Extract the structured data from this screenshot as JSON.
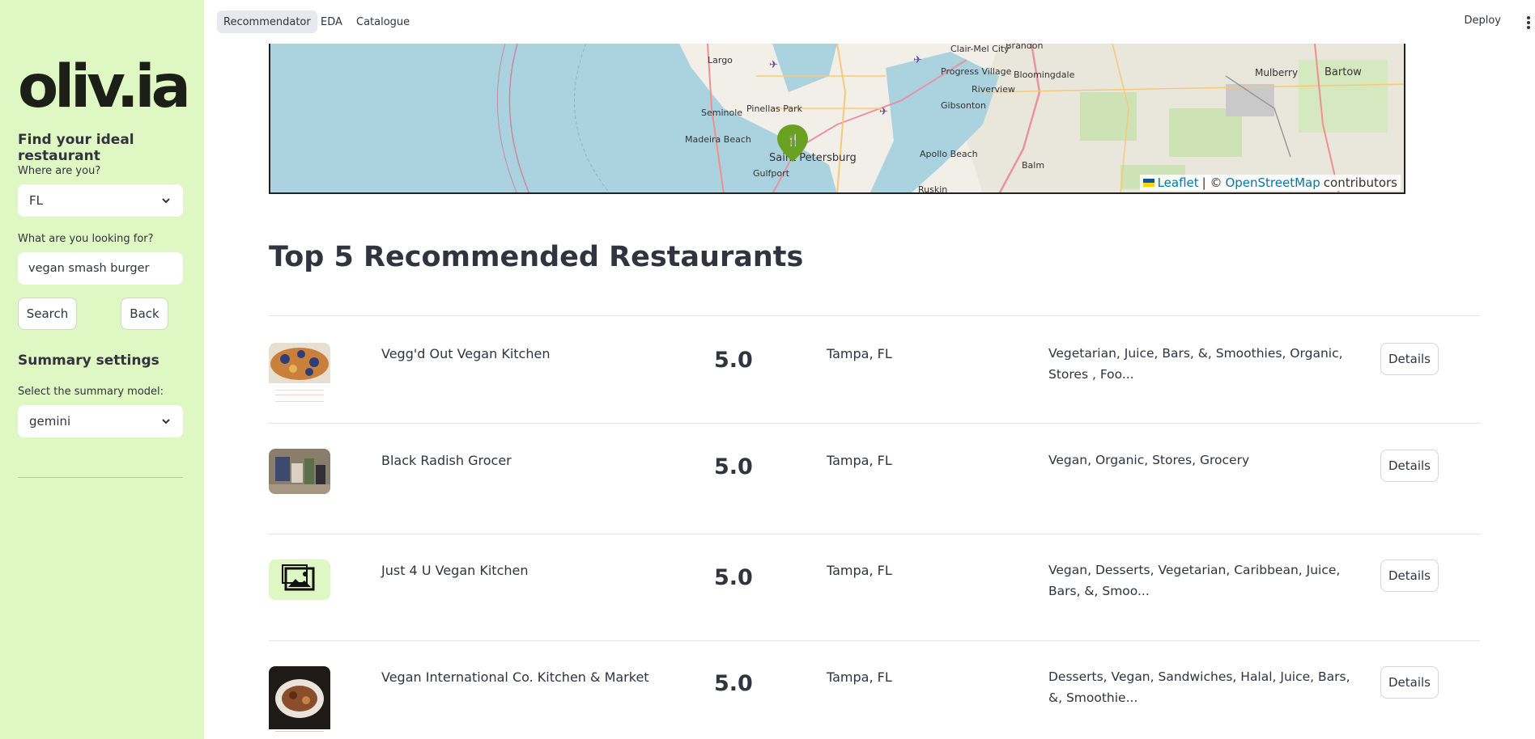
{
  "sidebar": {
    "logo": "oliv.ia",
    "heading": "Find your ideal restaurant",
    "location_label": "Where are you?",
    "location_value": "FL",
    "query_label": "What are you looking for?",
    "query_value": "vegan smash burger",
    "search_button": "Search",
    "back_button": "Back",
    "summary_heading": "Summary settings",
    "model_label": "Select the summary model:",
    "model_value": "gemini"
  },
  "header": {
    "tabs": [
      "Recommendator",
      "EDA",
      "Catalogue"
    ],
    "active_tab": "Recommendator",
    "deploy_label": "Deploy"
  },
  "map": {
    "places": [
      "Largo",
      "Clair-Mel City",
      "Brandon",
      "Progress Village",
      "Bloomingdale",
      "Mulberry",
      "Bartow",
      "Riverview",
      "Pinellas Park",
      "Seminole",
      "Gibsonton",
      "Madeira Beach",
      "Saint Petersburg",
      "Gulfport",
      "Apollo Beach",
      "Balm",
      "Ruskin"
    ],
    "attribution": {
      "leaflet": "Leaflet",
      "separator": "| ©",
      "osm": "OpenStreetMap",
      "suffix": "contributors"
    },
    "colors": {
      "water": "#aad3df",
      "land": "#f2efe9",
      "marker": "#6aa121"
    }
  },
  "main": {
    "title": "Top 5 Recommended Restaurants",
    "details_label": "Details",
    "restaurants": [
      {
        "name": "Vegg'd Out Vegan Kitchen",
        "rating": "5.0",
        "city": "Tampa, FL",
        "categories": "Vegetarian, Juice, Bars, &, Smoothies, Organic, Stores , Foo...",
        "image": "food-photo"
      },
      {
        "name": "Black Radish Grocer",
        "rating": "5.0",
        "city": "Tampa, FL",
        "categories": "Vegan, Organic, Stores, Grocery",
        "image": "grocery-photo"
      },
      {
        "name": "Just 4 U Vegan Kitchen",
        "rating": "5.0",
        "city": "Tampa, FL",
        "categories": "Vegan, Desserts, Vegetarian, Caribbean, Juice, Bars, &, Smoo...",
        "image": "image-placeholder-icon"
      },
      {
        "name": "Vegan International Co. Kitchen & Market",
        "rating": "5.0",
        "city": "Tampa, FL",
        "categories": "Desserts, Vegan, Sandwiches, Halal, Juice, Bars, &, Smoothie...",
        "image": "food-photo"
      }
    ]
  }
}
